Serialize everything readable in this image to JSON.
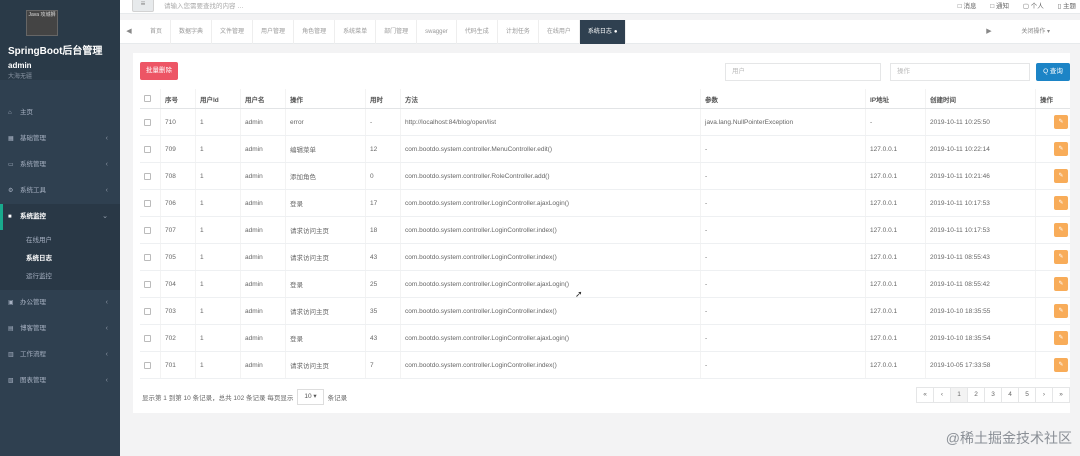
{
  "sidebar": {
    "logo_text": "Java 攻城狮",
    "brand": "SpringBoot后台管理",
    "user": "admin",
    "location": "大海无疆",
    "menu": [
      {
        "label": "主页",
        "icon": "home-icon"
      },
      {
        "label": "基础管理",
        "icon": "grid-icon"
      },
      {
        "label": "系统管理",
        "icon": "desktop-icon"
      },
      {
        "label": "系统工具",
        "icon": "gear-icon"
      },
      {
        "label": "系统监控",
        "icon": "video-icon",
        "active": true
      },
      {
        "label": "办公管理",
        "icon": "chat-icon"
      },
      {
        "label": "博客管理",
        "icon": "blog-icon"
      },
      {
        "label": "工作流程",
        "icon": "print-icon"
      },
      {
        "label": "图表管理",
        "icon": "chart-icon"
      }
    ],
    "submenu": [
      {
        "label": "在线用户"
      },
      {
        "label": "系统日志",
        "current": true
      },
      {
        "label": "运行监控"
      }
    ]
  },
  "topbar": {
    "menu_glyph": "≡",
    "search_placeholder": "请输入您需要查找的内容 …",
    "items": [
      "□ 消息",
      "□ 通知",
      "▢ 个人",
      "▯ 主题"
    ]
  },
  "tabs": {
    "items": [
      "首页",
      "数据字典",
      "文件管理",
      "用户管理",
      "角色管理",
      "系统菜单",
      "部门管理",
      "swagger",
      "代码生成",
      "计划任务",
      "在线用户",
      "系统日志"
    ],
    "active_index": 11,
    "close_action": "关闭操作 ▾"
  },
  "toolbar": {
    "delete_label": "批量删除",
    "user_placeholder": "用户",
    "operation_placeholder": "操作",
    "query_label": "Q 查询"
  },
  "table": {
    "headers": [
      "序号",
      "用户Id",
      "用户名",
      "操作",
      "用时",
      "方法",
      "参数",
      "IP地址",
      "创建时间",
      "操作"
    ],
    "rows": [
      [
        "710",
        "1",
        "admin",
        "error",
        "-",
        "http://localhost:84/blog/open/list",
        "java.lang.NullPointerException",
        "-",
        "2019-10-11 10:25:50"
      ],
      [
        "709",
        "1",
        "admin",
        "编辑菜单",
        "12",
        "com.bootdo.system.controller.MenuController.edit()",
        "-",
        "127.0.0.1",
        "2019-10-11 10:22:14"
      ],
      [
        "708",
        "1",
        "admin",
        "添加角色",
        "0",
        "com.bootdo.system.controller.RoleController.add()",
        "-",
        "127.0.0.1",
        "2019-10-11 10:21:46"
      ],
      [
        "706",
        "1",
        "admin",
        "登录",
        "17",
        "com.bootdo.system.controller.LoginController.ajaxLogin()",
        "-",
        "127.0.0.1",
        "2019-10-11 10:17:53"
      ],
      [
        "707",
        "1",
        "admin",
        "请求访问主页",
        "18",
        "com.bootdo.system.controller.LoginController.index()",
        "-",
        "127.0.0.1",
        "2019-10-11 10:17:53"
      ],
      [
        "705",
        "1",
        "admin",
        "请求访问主页",
        "43",
        "com.bootdo.system.controller.LoginController.index()",
        "-",
        "127.0.0.1",
        "2019-10-11 08:55:43"
      ],
      [
        "704",
        "1",
        "admin",
        "登录",
        "25",
        "com.bootdo.system.controller.LoginController.ajaxLogin()",
        "-",
        "127.0.0.1",
        "2019-10-11 08:55:42"
      ],
      [
        "703",
        "1",
        "admin",
        "请求访问主页",
        "35",
        "com.bootdo.system.controller.LoginController.index()",
        "-",
        "127.0.0.1",
        "2019-10-10 18:35:55"
      ],
      [
        "702",
        "1",
        "admin",
        "登录",
        "43",
        "com.bootdo.system.controller.LoginController.ajaxLogin()",
        "-",
        "127.0.0.1",
        "2019-10-10 18:35:54"
      ],
      [
        "701",
        "1",
        "admin",
        "请求访问主页",
        "7",
        "com.bootdo.system.controller.LoginController.index()",
        "-",
        "127.0.0.1",
        "2019-10-05 17:33:58"
      ]
    ],
    "action_icon": "edit-icon"
  },
  "footer": {
    "summary_prefix": "显示第 1 到第 10 条记录，总共 102 条记录 每页显示",
    "page_size": "10 ▾",
    "summary_suffix": "条记录"
  },
  "pagination": [
    "«",
    "‹",
    "1",
    "2",
    "3",
    "4",
    "5",
    "›",
    "»"
  ],
  "watermark": "@稀土掘金技术社区",
  "colors": {
    "sidebar": "#2f4050",
    "danger": "#ed5565",
    "primary": "#1c84c6",
    "warning": "#f8ac59",
    "active_tab": "#2f4050"
  }
}
